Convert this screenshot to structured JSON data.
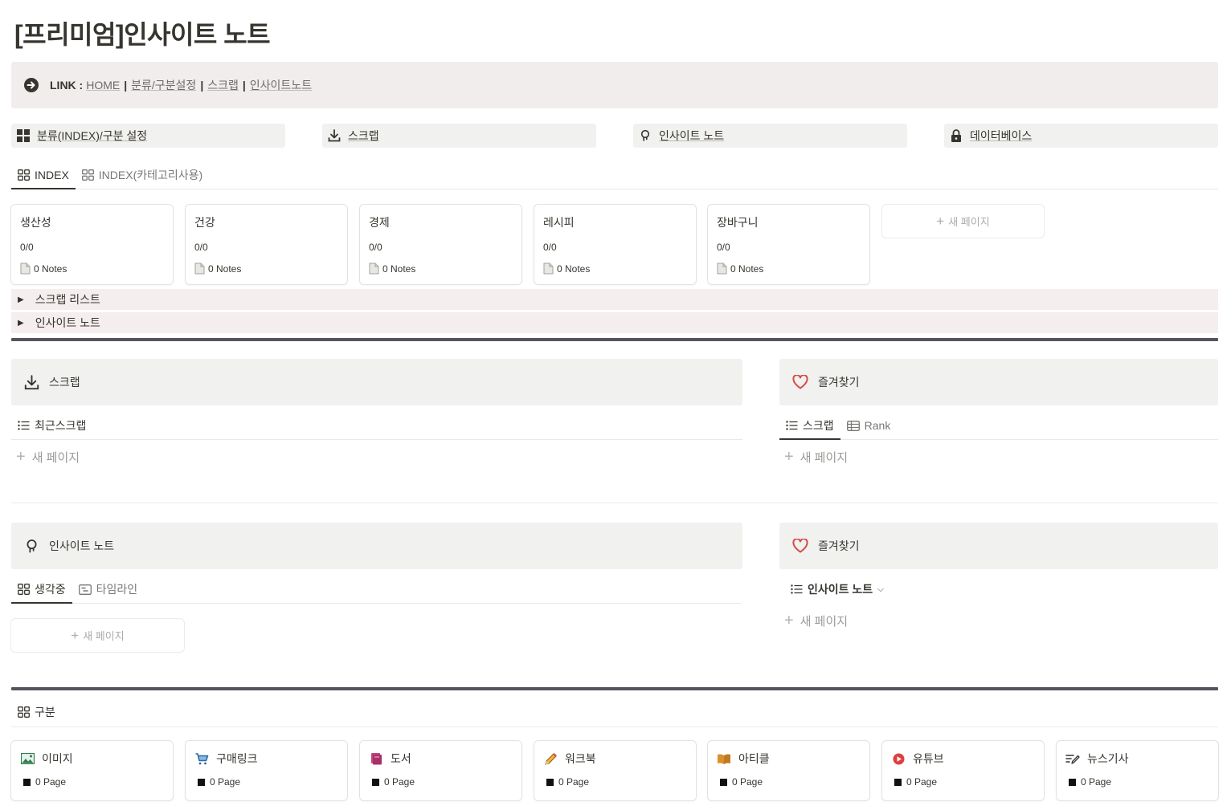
{
  "page": {
    "title": "[프리미엄]인사이트 노트"
  },
  "link_callout": {
    "label": "LINK :",
    "links": [
      "HOME",
      "분류/구분설정",
      "스크랩",
      "인사이트노트"
    ],
    "separator": "|"
  },
  "nav_buttons": [
    {
      "label": "분류(INDEX)/구분 설정",
      "icon": "grid-icon"
    },
    {
      "label": "스크랩",
      "icon": "download-icon"
    },
    {
      "label": "인사이트 노트",
      "icon": "lightbulb-icon"
    },
    {
      "label": "데이터베이스",
      "icon": "lock-icon"
    }
  ],
  "index_tabs": [
    {
      "label": "INDEX",
      "active": true
    },
    {
      "label": "INDEX(카테고리사용)",
      "active": false
    }
  ],
  "index_cards": [
    {
      "title": "생산성",
      "count": "0/0",
      "notes": "0 Notes"
    },
    {
      "title": "건강",
      "count": "0/0",
      "notes": "0 Notes"
    },
    {
      "title": "경제",
      "count": "0/0",
      "notes": "0 Notes"
    },
    {
      "title": "레시피",
      "count": "0/0",
      "notes": "0 Notes"
    },
    {
      "title": "장바구니",
      "count": "0/0",
      "notes": "0 Notes"
    }
  ],
  "new_page_label": "새 페이지",
  "toggles": [
    "스크랩 리스트",
    "인사이트 노트"
  ],
  "scrap_section": {
    "title": "스크랩",
    "view_label": "최근스크랩",
    "new_page": "새 페이지"
  },
  "favorites_1": {
    "title": "즐겨찾기",
    "tabs": [
      {
        "label": "스크랩",
        "active": true
      },
      {
        "label": "Rank",
        "active": false
      }
    ],
    "new_page": "새 페이지"
  },
  "insight_section": {
    "title": "인사이트 노트",
    "tabs": [
      {
        "label": "생각중",
        "active": true
      },
      {
        "label": "타임라인",
        "active": false
      }
    ],
    "new_page": "새 페이지"
  },
  "favorites_2": {
    "title": "즐겨찾기",
    "view_label": "인사이트 노트",
    "new_page": "새 페이지"
  },
  "category_section": {
    "view_label": "구분",
    "cards": [
      {
        "title": "이미지",
        "pages": "0 Page",
        "icon": "image-icon"
      },
      {
        "title": "구매링크",
        "pages": "0 Page",
        "icon": "cart-icon"
      },
      {
        "title": "도서",
        "pages": "0 Page",
        "icon": "book-icon"
      },
      {
        "title": "워크북",
        "pages": "0 Page",
        "icon": "pencil-icon"
      },
      {
        "title": "아티클",
        "pages": "0 Page",
        "icon": "open-book-icon"
      },
      {
        "title": "유튜브",
        "pages": "0 Page",
        "icon": "play-icon"
      },
      {
        "title": "뉴스기사",
        "pages": "0 Page",
        "icon": "write-icon"
      }
    ]
  },
  "colors": {
    "callout_pink": "#f1eded",
    "callout_gray": "#f1f1ef",
    "divider_dark": "#55535f",
    "heart_red": "#d44c47"
  }
}
